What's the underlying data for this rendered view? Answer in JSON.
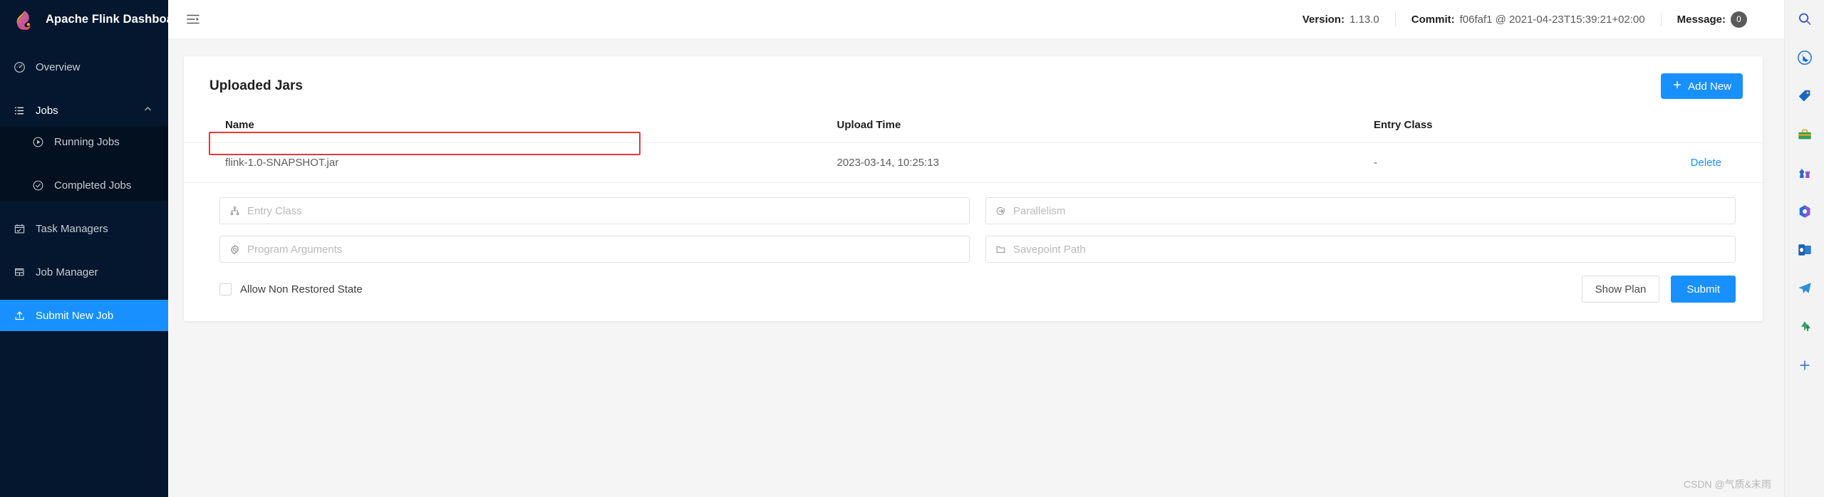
{
  "brand": {
    "title": "Apache Flink Dashboard",
    "logo_icon": "flink-squirrel-logo"
  },
  "sidebar": {
    "items": [
      {
        "label": "Overview",
        "icon": "dashboard-icon",
        "active": false,
        "sub": false
      },
      {
        "label": "Jobs",
        "icon": "list-icon",
        "active": false,
        "sub": false,
        "expanded": true
      },
      {
        "label": "Running Jobs",
        "icon": "play-circle-icon",
        "active": false,
        "sub": true
      },
      {
        "label": "Completed Jobs",
        "icon": "check-circle-icon",
        "active": false,
        "sub": true
      },
      {
        "label": "Task Managers",
        "icon": "calendar-check-icon",
        "active": false,
        "sub": false
      },
      {
        "label": "Job Manager",
        "icon": "layout-blocks-icon",
        "active": false,
        "sub": false
      },
      {
        "label": "Submit New Job",
        "icon": "upload-icon",
        "active": true,
        "sub": false
      }
    ],
    "active_bg": "#1890ff",
    "bg": "#05172e"
  },
  "topbar": {
    "fold_icon": "menu-fold-icon",
    "version_label": "Version:",
    "version_value": "1.13.0",
    "commit_label": "Commit:",
    "commit_value": "f06faf1 @ 2021-04-23T15:39:21+02:00",
    "message_label": "Message:",
    "message_count": "0"
  },
  "card": {
    "title": "Uploaded Jars",
    "add_new_label": "Add New",
    "add_new_icon": "plus-icon",
    "accent_color": "#1890ff"
  },
  "table": {
    "columns": [
      "Name",
      "Upload Time",
      "Entry Class",
      ""
    ],
    "rows": [
      {
        "name": "flink-1.0-SNAPSHOT.jar",
        "upload_time": "2023-03-14, 10:25:13",
        "entry_class": "-",
        "action": "Delete"
      }
    ]
  },
  "form": {
    "entry_class": {
      "placeholder": "Entry Class",
      "value": "",
      "icon": "cluster-icon"
    },
    "parallelism": {
      "placeholder": "Parallelism",
      "value": "",
      "icon": "login-arrow-icon"
    },
    "program_arguments": {
      "placeholder": "Program Arguments",
      "value": "",
      "icon": "gear-icon"
    },
    "savepoint_path": {
      "placeholder": "Savepoint Path",
      "value": "",
      "icon": "folder-icon"
    },
    "allow_non_restored_state": {
      "label": "Allow Non Restored State",
      "checked": false
    },
    "show_plan_label": "Show Plan",
    "submit_label": "Submit"
  },
  "annotation": {
    "color": "#e4393c"
  },
  "rail": {
    "items": [
      {
        "icon": "search-icon"
      },
      {
        "icon": "bing-copilot-icon"
      },
      {
        "icon": "shopping-tag-icon"
      },
      {
        "icon": "toolbox-icon"
      },
      {
        "icon": "games-chess-icon"
      },
      {
        "icon": "microsoft-365-icon"
      },
      {
        "icon": "outlook-icon"
      },
      {
        "icon": "telegram-send-icon"
      },
      {
        "icon": "trees-icon"
      },
      {
        "icon": "add-plus-icon"
      }
    ]
  },
  "watermark": {
    "text": "CSDN @气质&末雨"
  }
}
